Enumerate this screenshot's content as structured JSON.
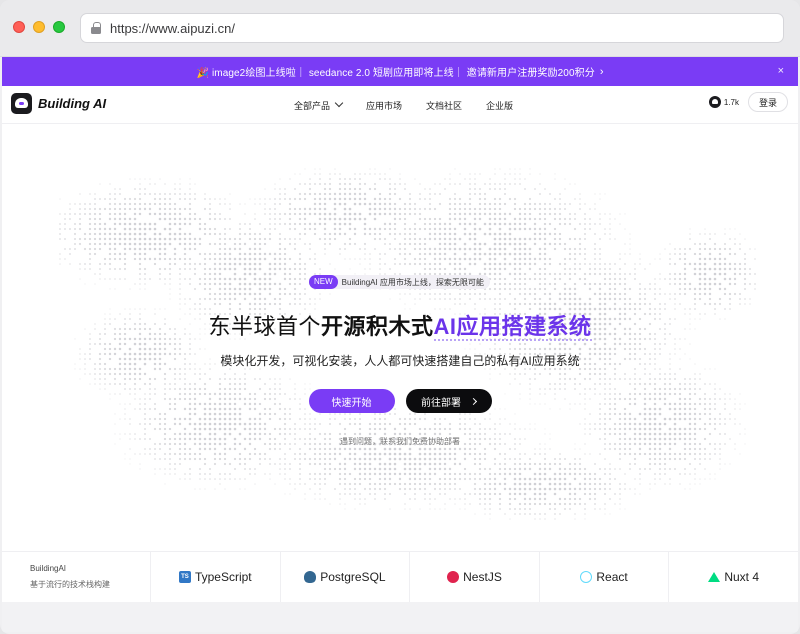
{
  "browser": {
    "url": "https://www.aipuzi.cn/"
  },
  "announcement": {
    "text": "🎉 image2绘图上线啦｜ seedance 2.0 短剧应用即将上线｜ 邀请新用户注册奖励200积分",
    "chevron": "›",
    "close": "×"
  },
  "nav": {
    "brand": "Building AI",
    "menu": [
      "全部产品",
      "应用市场",
      "文档社区",
      "企业版"
    ],
    "github_stars": "1.7k",
    "login": "登录"
  },
  "hero": {
    "badge_new": "NEW",
    "badge_text": "BuildingAI 应用市场上线，探索无限可能",
    "headline_pre": "东半球首个",
    "headline_bold": "开源积木式",
    "headline_accent": "AI应用搭建系统",
    "subtitle": "模块化开发，可视化安装，人人都可快速搭建自己的私有AI应用系统",
    "primary_button": "快速开始",
    "secondary_button": "前往部署",
    "help_text": "遇到问题，联系我们免费协助部署"
  },
  "techbar": {
    "title": "BuildingAI",
    "subtitle": "基于流行的技术栈构建",
    "items": [
      {
        "name": "TypeScript",
        "icon": "typescript-icon",
        "glyph": "TS"
      },
      {
        "name": "PostgreSQL",
        "icon": "postgresql-icon",
        "glyph": ""
      },
      {
        "name": "NestJS",
        "icon": "nestjs-icon",
        "glyph": ""
      },
      {
        "name": "React",
        "icon": "react-icon",
        "glyph": ""
      },
      {
        "name": "Nuxt 4",
        "icon": "nuxt-icon",
        "glyph": ""
      }
    ]
  },
  "colors": {
    "accent": "#7a3cf5",
    "accent_text": "#6b34ea",
    "dark_button": "#0c0c0e"
  }
}
